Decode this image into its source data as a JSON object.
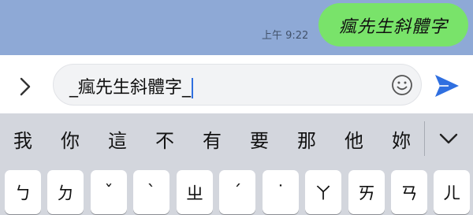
{
  "chat": {
    "message_time": "上午 9:22",
    "message_text": "瘋先生斜體字"
  },
  "composer": {
    "input_value": "_瘋先生斜體字_"
  },
  "keyboard": {
    "candidates": [
      "我",
      "你",
      "這",
      "不",
      "有",
      "要",
      "那",
      "他",
      "妳"
    ],
    "keys": [
      "ㄅ",
      "ㄉ",
      "ˇ",
      "ˋ",
      "ㄓ",
      "ˊ",
      "˙",
      "ㄚ",
      "ㄞ",
      "ㄢ",
      "ㄦ"
    ]
  },
  "colors": {
    "chat_bg": "#8ea9d6",
    "bubble": "#79e36a",
    "send_accent": "#2f6fe0",
    "keyboard_bg": "#d3d6dd"
  },
  "icons": {
    "expand": "chevron-right-icon",
    "emoji": "smiley-icon",
    "send": "send-arrow-icon",
    "collapse": "chevron-down-icon"
  }
}
